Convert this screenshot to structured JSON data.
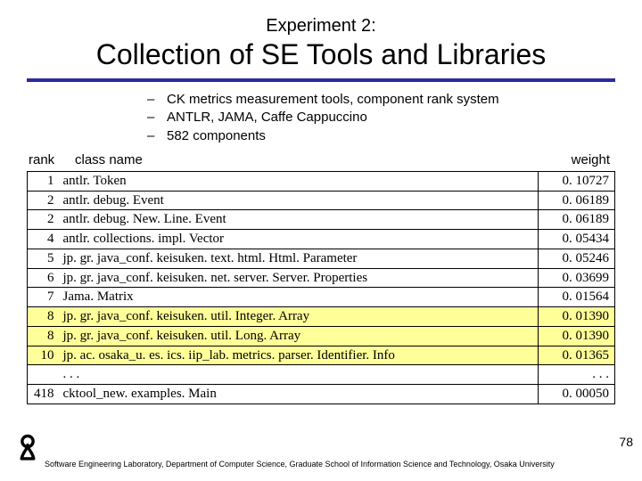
{
  "title": {
    "sup": "Experiment 2:",
    "main": "Collection of SE Tools and Libraries"
  },
  "bullets": [
    "CK metrics measurement tools, component rank system",
    " ANTLR, JAMA, Caffe Cappuccino",
    "582 components"
  ],
  "table": {
    "headers": {
      "rank": "rank",
      "class_name": "class name",
      "weight": "weight"
    },
    "rows": [
      {
        "rank": "1",
        "name": "antlr. Token",
        "weight": "0. 10727",
        "hl": false
      },
      {
        "rank": "2",
        "name": "antlr. debug. Event",
        "weight": "0. 06189",
        "hl": false
      },
      {
        "rank": "2",
        "name": "antlr. debug. New. Line. Event",
        "weight": "0. 06189",
        "hl": false
      },
      {
        "rank": "4",
        "name": "antlr. collections. impl. Vector",
        "weight": "0. 05434",
        "hl": false
      },
      {
        "rank": "5",
        "name": "jp. gr. java_conf. keisuken. text. html. Html. Parameter",
        "weight": "0. 05246",
        "hl": false
      },
      {
        "rank": "6",
        "name": "jp. gr. java_conf. keisuken. net. server. Server. Properties",
        "weight": "0. 03699",
        "hl": false
      },
      {
        "rank": "7",
        "name": "Jama. Matrix",
        "weight": "0. 01564",
        "hl": false
      },
      {
        "rank": "8",
        "name": " jp. gr. java_conf. keisuken. util. Integer. Array",
        "weight": "0. 01390",
        "hl": true
      },
      {
        "rank": "8",
        "name": " jp. gr. java_conf. keisuken. util. Long. Array",
        "weight": "0. 01390",
        "hl": true
      },
      {
        "rank": "10",
        "name": "jp. ac. osaka_u. es. ics. iip_lab. metrics. parser. Identifier. Info",
        "weight": "0. 01365",
        "hl": true
      },
      {
        "rank": "",
        "name": " . . . ",
        "weight": ". . . ",
        "hl": false
      },
      {
        "rank": "418",
        "name": "cktool_new. examples. Main",
        "weight": "0. 00050",
        "hl": false
      }
    ]
  },
  "footer": "Software Engineering Laboratory, Department of Computer Science, Graduate School of Information Science and Technology, Osaka University",
  "page_number": "78",
  "chart_data": {
    "type": "table",
    "title": "Collection of SE Tools and Libraries — component ranks (582 components)",
    "columns": [
      "rank",
      "class name",
      "weight"
    ],
    "rows": [
      [
        1,
        "antlr.Token",
        0.10727
      ],
      [
        2,
        "antlr.debug.Event",
        0.06189
      ],
      [
        2,
        "antlr.debug.NewLineEvent",
        0.06189
      ],
      [
        4,
        "antlr.collections.impl.Vector",
        0.05434
      ],
      [
        5,
        "jp.gr.java_conf.keisuken.text.html.HtmlParameter",
        0.05246
      ],
      [
        6,
        "jp.gr.java_conf.keisuken.net.server.ServerProperties",
        0.03699
      ],
      [
        7,
        "Jama.Matrix",
        0.01564
      ],
      [
        8,
        "jp.gr.java_conf.keisuken.util.IntegerArray",
        0.0139
      ],
      [
        8,
        "jp.gr.java_conf.keisuken.util.LongArray",
        0.0139
      ],
      [
        10,
        "jp.ac.osaka_u.es.ics.iip_lab.metrics.parser.IdentifierInfo",
        0.01365
      ],
      [
        418,
        "cktool_new.examples.Main",
        0.0005
      ]
    ]
  }
}
